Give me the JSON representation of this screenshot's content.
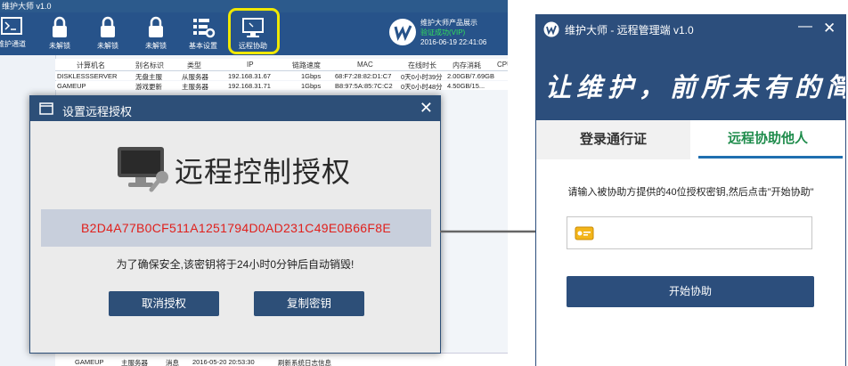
{
  "background_app": {
    "title": "维护大师 v1.0",
    "toolbar": [
      {
        "label": "维护通道",
        "icon": "terminal-icon"
      },
      {
        "label": "未解锁",
        "icon": "lock-icon"
      },
      {
        "label": "未解锁",
        "icon": "lock-icon"
      },
      {
        "label": "未解锁",
        "icon": "lock-icon"
      },
      {
        "label": "基本设置",
        "icon": "settings-icon"
      },
      {
        "label": "远程协助",
        "icon": "remote-monitor-icon"
      }
    ],
    "brand": {
      "line1": "维护大师产品展示",
      "line2": "验证成功(VIP)",
      "line3": "2016-06-19 22:41:06"
    },
    "columns": [
      "计算机名",
      "别名标识",
      "类型",
      "IP",
      "链路速度",
      "MAC",
      "在线时长",
      "内存消耗",
      "CPU"
    ],
    "rows": [
      [
        "DISKLESSSERVER",
        "无盘主服",
        "从服务器",
        "192.168.31.67",
        "1Gbps",
        "68:F7:28:82:D1:C7",
        "0天0小时39分",
        "2.00GB/7.69GB"
      ],
      [
        "GAMEUP",
        "游戏更新",
        "主服务器",
        "192.168.31.71",
        "1Gbps",
        "B8:97:5A:85:7C:C2",
        "0天0小时48分",
        "4.50GB/15..."
      ]
    ],
    "bottom_row": [
      "GAMEUP",
      "主服务器",
      "消息",
      "2016-05-20 20:53:30",
      "刷新系统日志信息"
    ]
  },
  "dialog": {
    "title": "设置远程授权",
    "heading": "远程控制授权",
    "key": "B2D4A77B0CF511A1251794D0AD231C49E0B66F8E",
    "warning": "为了确保安全,该密钥将于24小时0分钟后自动销毁!",
    "cancel_label": "取消授权",
    "copy_label": "复制密钥",
    "close_glyph": "✕"
  },
  "right_app": {
    "title": "维护大师 - 远程管理端 v1.0",
    "minimize_glyph": "—",
    "close_glyph": "✕",
    "banner": "让维护，前所未有的简单",
    "tabs": [
      {
        "label": "登录通行证"
      },
      {
        "label": "远程协助他人"
      }
    ],
    "instruction": "请输入被协助方提供的40位授权密钥,然后点击\"开始协助\"",
    "key_input_value": "",
    "start_label": "开始协助"
  },
  "colors": {
    "toolbar_bg": "#27538a",
    "dialog_title_bg": "#2d4f78",
    "key_text": "#e0201c",
    "highlight": "#f0e800",
    "active_tab": "#1f8c4c"
  }
}
